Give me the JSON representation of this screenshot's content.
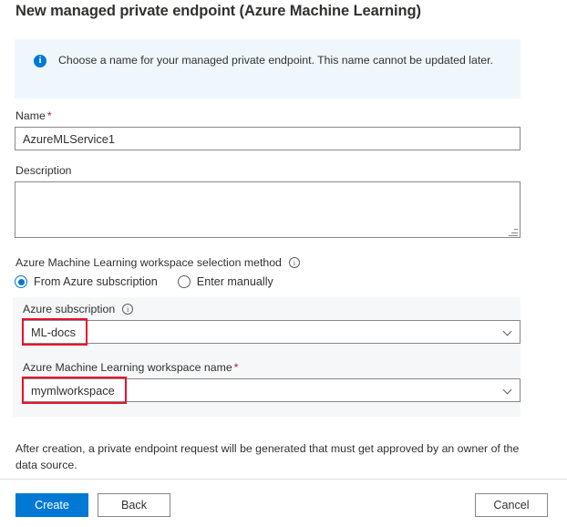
{
  "page": {
    "title": "New managed private endpoint (Azure Machine Learning)"
  },
  "info_banner": {
    "icon": "info-circle-filled-icon",
    "text": "Choose a name for your managed private endpoint. This name cannot be updated later.",
    "background_color": "#eff6fc",
    "icon_color": "#0078d4"
  },
  "form": {
    "name": {
      "label": "Name",
      "required_marker": "*",
      "value": "AzureMLService1",
      "placeholder": ""
    },
    "description": {
      "label": "Description",
      "value": "",
      "placeholder": ""
    },
    "selection_method": {
      "label": "Azure Machine Learning workspace selection method",
      "info_icon": "info-circle-outline-icon",
      "options": [
        {
          "label": "From Azure subscription",
          "selected": true
        },
        {
          "label": "Enter manually",
          "selected": false
        }
      ]
    },
    "subscription": {
      "label": "Azure subscription",
      "info_icon": "info-circle-outline-icon",
      "value": "ML-docs",
      "chevron": "chevron-down-icon",
      "highlighted": true
    },
    "workspace": {
      "label": "Azure Machine Learning workspace name",
      "required_marker": "*",
      "value": "mymlworkspace",
      "chevron": "chevron-down-icon",
      "highlighted": true
    }
  },
  "footer": {
    "note": "After creation, a private endpoint request will be generated that must get approved by an owner of the data source.",
    "create_label": "Create",
    "back_label": "Back",
    "cancel_label": "Cancel"
  },
  "colors": {
    "accent": "#0078d4",
    "required_star": "#a4262c",
    "annotation": "#e8112d",
    "panel": "#f6f7f8",
    "border": "#8a8886"
  }
}
